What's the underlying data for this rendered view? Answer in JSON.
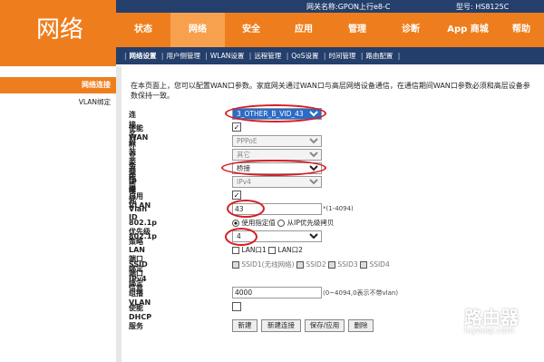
{
  "logo": "网络",
  "header": {
    "gateway_name": "网关名称:GPON上行e8-C",
    "model": "型号: HS8125C"
  },
  "mainnav": [
    "状态",
    "网络",
    "安全",
    "应用",
    "管理",
    "诊断",
    "App 商城",
    "帮助"
  ],
  "subnav": [
    "网络设置",
    "用户侧管理",
    "WLAN设置",
    "远程管理",
    "QoS设置",
    "时间管理",
    "路由配置"
  ],
  "left": {
    "selected": "网络连接",
    "vlan": "VLAN绑定"
  },
  "desc": "在本页面上，您可以配置WAN口参数。家庭网关通过WAN口与高层网络设备通信，在通信期间WAN口参数必须和高层设备参数保持一致。",
  "form": {
    "conn_name_label": "连接名称",
    "conn_name_value": "3_OTHER_B_VID_43",
    "enable_wan_label": "使能WAN",
    "encap_label": "封装类型",
    "encap_value": "PPPoE",
    "service_label": "业务类型",
    "service_value": "其它",
    "mode_label": "连接模式",
    "mode_value": "桥接",
    "ip_mode_label": "IP模式",
    "ip_mode_value": "IPv4",
    "enable_vlan_label": "启用VLAN",
    "vlan_id_label": "Vlan ID",
    "vlan_id_value": "43",
    "vlan_id_note": "*(1-4094)",
    "policy_label": "802.1p优先级策略",
    "policy_opt1": "使用指定值",
    "policy_opt2": "从IP优先级拷贝",
    "p8021_label": "802.1p",
    "p8021_value": "4",
    "lan_bind_label": "LAN端口绑定",
    "lan1": "LAN口1",
    "lan2": "LAN口2",
    "ssid_bind_label": "SSID端口绑定",
    "ssid1": "SSID1(无线网络)",
    "ssid2": "SSID2",
    "ssid3": "SSID3",
    "ssid4": "SSID4",
    "ipv4_label": "IPv4信息",
    "mcast_label": "组播VLAN",
    "mcast_value": "4000",
    "mcast_note": "(0~4094,0表示不带vlan)",
    "dhcp_label": "使能DHCP服务"
  },
  "buttons": {
    "new": "新建",
    "new_conn": "新建连接",
    "save": "保存/应用",
    "delete": "删除"
  },
  "watermark": {
    "text": "路由器",
    "sub": "luyouqi.com"
  }
}
